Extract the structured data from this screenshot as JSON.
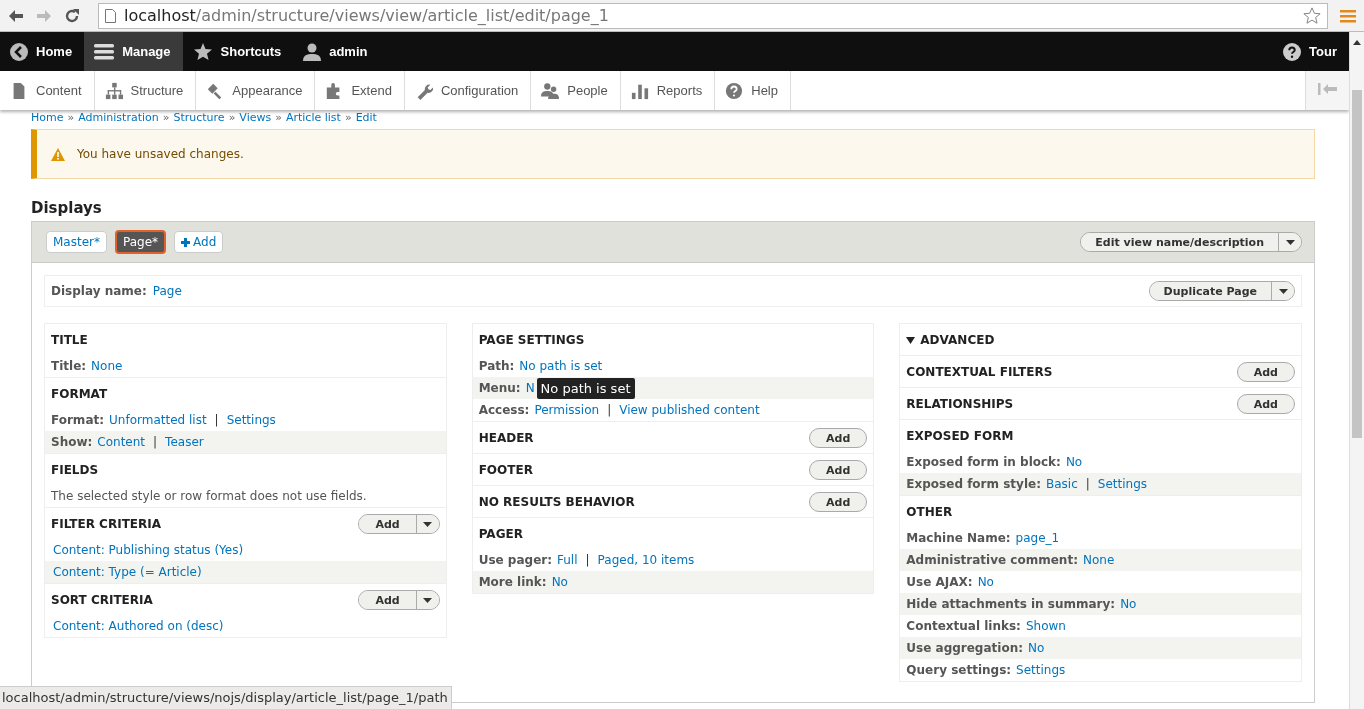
{
  "browser": {
    "url_host": "localhost",
    "url_path": "/admin/structure/views/view/article_list/edit/page_1"
  },
  "toolbar": {
    "items": [
      {
        "label": "Home",
        "kind": "back",
        "selected": false
      },
      {
        "label": "Manage",
        "kind": "menu",
        "selected": true
      },
      {
        "label": "Shortcuts",
        "kind": "star",
        "selected": false
      },
      {
        "label": "admin",
        "kind": "user",
        "selected": false
      }
    ],
    "tour": "Tour"
  },
  "tray": [
    {
      "label": "Content",
      "kind": "content"
    },
    {
      "label": "Structure",
      "kind": "structure"
    },
    {
      "label": "Appearance",
      "kind": "appearance"
    },
    {
      "label": "Extend",
      "kind": "extend"
    },
    {
      "label": "Configuration",
      "kind": "config"
    },
    {
      "label": "People",
      "kind": "people"
    },
    {
      "label": "Reports",
      "kind": "reports"
    },
    {
      "label": "Help",
      "kind": "help"
    }
  ],
  "breadcrumb": [
    "Home",
    "Administration",
    "Structure",
    "Views",
    "Article list",
    "Edit"
  ],
  "breadcrumb_separator": "»",
  "link_separator": "|",
  "message": "You have unsaved changes.",
  "displays": {
    "heading": "Displays",
    "tabs": [
      {
        "label": "Master*",
        "kind": "tab",
        "selected": false
      },
      {
        "label": "Page*",
        "kind": "tab",
        "selected": true
      },
      {
        "label": "Add",
        "kind": "add",
        "selected": false
      }
    ],
    "edit_button": "Edit view name/description",
    "display_name_label": "Display name:",
    "display_name": "Page",
    "duplicate_button": "Duplicate Page"
  },
  "columns": [
    [
      {
        "title": "TITLE",
        "rows": [
          {
            "label": "Title:",
            "links": [
              "None"
            ]
          }
        ]
      },
      {
        "title": "FORMAT",
        "rows": [
          {
            "label": "Format:",
            "links": [
              "Unformatted list",
              "Settings"
            ]
          },
          {
            "label": "Show:",
            "links": [
              "Content",
              "Teaser"
            ]
          }
        ]
      },
      {
        "title": "FIELDS",
        "text": "The selected style or row format does not use fields."
      },
      {
        "title": "FILTER CRITERIA",
        "add": {
          "label": "Add",
          "kind": "split"
        },
        "rows": [
          {
            "links": [
              "Content: Publishing status (Yes)"
            ]
          },
          {
            "links": [
              "Content: Type (= Article)"
            ]
          }
        ]
      },
      {
        "title": "SORT CRITERIA",
        "add": {
          "label": "Add",
          "kind": "split"
        },
        "rows": [
          {
            "links": [
              "Content: Authored on (desc)"
            ]
          }
        ]
      }
    ],
    [
      {
        "title": "PAGE SETTINGS",
        "rows": [
          {
            "label": "Path:",
            "links": [
              "No path is set"
            ]
          },
          {
            "label": "Menu:",
            "links": [
              "N"
            ],
            "tooltip": "No path is set"
          },
          {
            "label": "Access:",
            "links": [
              "Permission",
              "View published content"
            ]
          }
        ]
      },
      {
        "title": "HEADER",
        "add": {
          "label": "Add",
          "kind": "single"
        }
      },
      {
        "title": "FOOTER",
        "add": {
          "label": "Add",
          "kind": "single"
        }
      },
      {
        "title": "NO RESULTS BEHAVIOR",
        "add": {
          "label": "Add",
          "kind": "single"
        }
      },
      {
        "title": "PAGER",
        "rows": [
          {
            "label": "Use pager:",
            "links": [
              "Full",
              "Paged, 10 items"
            ]
          },
          {
            "label": "More link:",
            "links": [
              "No"
            ]
          }
        ]
      }
    ],
    [
      {
        "title": "ADVANCED",
        "expanded": true
      },
      {
        "title": "CONTEXTUAL FILTERS",
        "add": {
          "label": "Add",
          "kind": "single"
        }
      },
      {
        "title": "RELATIONSHIPS",
        "add": {
          "label": "Add",
          "kind": "single"
        }
      },
      {
        "title": "EXPOSED FORM",
        "rows": [
          {
            "label": "Exposed form in block:",
            "links": [
              "No"
            ]
          },
          {
            "label": "Exposed form style:",
            "links": [
              "Basic",
              "Settings"
            ]
          }
        ]
      },
      {
        "title": "OTHER",
        "rows": [
          {
            "label": "Machine Name:",
            "links": [
              "page_1"
            ]
          },
          {
            "label": "Administrative comment:",
            "links": [
              "None"
            ]
          },
          {
            "label": "Use AJAX:",
            "links": [
              "No"
            ]
          },
          {
            "label": "Hide attachments in summary:",
            "links": [
              "No"
            ]
          },
          {
            "label": "Contextual links:",
            "links": [
              "Shown"
            ]
          },
          {
            "label": "Use aggregation:",
            "links": [
              "No"
            ]
          },
          {
            "label": "Query settings:",
            "links": [
              "Settings"
            ]
          }
        ]
      }
    ]
  ],
  "status_url": "localhost/admin/structure/views/nojs/display/article_list/page_1/path"
}
